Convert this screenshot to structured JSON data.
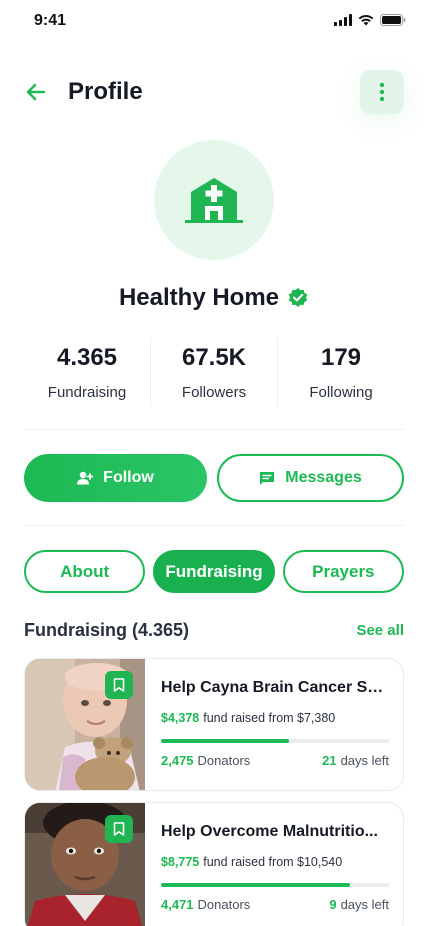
{
  "status_bar": {
    "time": "9:41"
  },
  "header": {
    "title": "Profile"
  },
  "profile": {
    "name": "Healthy Home",
    "verified": true
  },
  "stats": [
    {
      "value": "4.365",
      "label": "Fundraising"
    },
    {
      "value": "67.5K",
      "label": "Followers"
    },
    {
      "value": "179",
      "label": "Following"
    }
  ],
  "actions": {
    "follow_label": "Follow",
    "messages_label": "Messages"
  },
  "tabs": [
    {
      "label": "About",
      "active": false
    },
    {
      "label": "Fundraising",
      "active": true
    },
    {
      "label": "Prayers",
      "active": false
    }
  ],
  "section": {
    "title": "Fundraising (4.365)",
    "see_all": "See all"
  },
  "campaigns": [
    {
      "title": "Help Cayna Brain Cancer Su...",
      "raised": "$4,378",
      "goal_text": "fund raised from $7,380",
      "progress": 0.56,
      "donators": "2,475",
      "donators_label": "Donators",
      "days": "21",
      "days_label": "days left"
    },
    {
      "title": "Help Overcome Malnutritio...",
      "raised": "$8,775",
      "goal_text": "fund raised from $10,540",
      "progress": 0.83,
      "donators": "4,471",
      "donators_label": "Donators",
      "days": "9",
      "days_label": "days left"
    }
  ],
  "colors": {
    "accent": "#1db954",
    "accent_light": "#e6f7ec",
    "text": "#1d2433"
  },
  "icons": [
    "back-arrow-icon",
    "more-vertical-icon",
    "hospital-icon",
    "verified-badge-icon",
    "add-user-icon",
    "message-icon",
    "bookmark-icon"
  ]
}
